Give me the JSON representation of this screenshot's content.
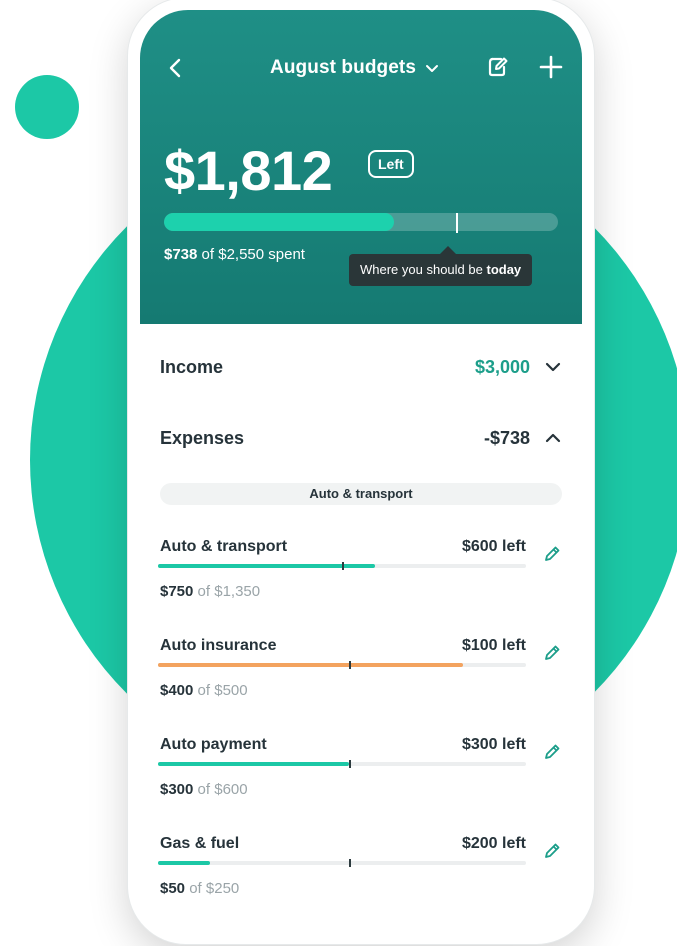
{
  "colors": {
    "accent": "#1cc8a6",
    "header_bg": "#1a8a81",
    "income_value": "#1c9e8a",
    "bar_green": "#1cc8a6",
    "bar_orange": "#f3a35f",
    "text_dark": "#26333a",
    "text_muted": "#9aa4a8"
  },
  "header": {
    "back_icon": "chevron-left-icon",
    "title": "August budgets",
    "title_icon": "chevron-down-icon",
    "note_icon": "note-edit-icon",
    "add_icon": "plus-icon",
    "amount_left": "$1,812",
    "left_badge": "Left",
    "progress_fraction": 0.585,
    "today_fraction": 0.74,
    "spent": "$738",
    "spent_suffix": "of $2,550 spent",
    "tooltip_prefix": "Where you should be",
    "tooltip_bold": "today"
  },
  "income": {
    "label": "Income",
    "value": "$3,000",
    "icon": "chevron-down-icon"
  },
  "expenses": {
    "label": "Expenses",
    "value": "-$738",
    "icon": "chevron-up-icon"
  },
  "category_chip": "Auto & transport",
  "items": [
    {
      "name": "Auto & transport",
      "left": "$600 left",
      "spent": "$750",
      "of": "of",
      "total": "$1,350",
      "progress": 0.59,
      "today": 0.5,
      "color": "#1cc8a6"
    },
    {
      "name": "Auto insurance",
      "left": "$100 left",
      "spent": "$400",
      "of": "of",
      "total": "$500",
      "progress": 0.83,
      "today": 0.52,
      "color": "#f3a35f"
    },
    {
      "name": "Auto payment",
      "left": "$300 left",
      "spent": "$300",
      "of": "of",
      "total": "$600",
      "progress": 0.52,
      "today": 0.52,
      "color": "#1cc8a6"
    },
    {
      "name": "Gas & fuel",
      "left": "$200 left",
      "spent": "$50",
      "of": "of",
      "total": "$250",
      "progress": 0.14,
      "today": 0.52,
      "color": "#1cc8a6"
    }
  ]
}
